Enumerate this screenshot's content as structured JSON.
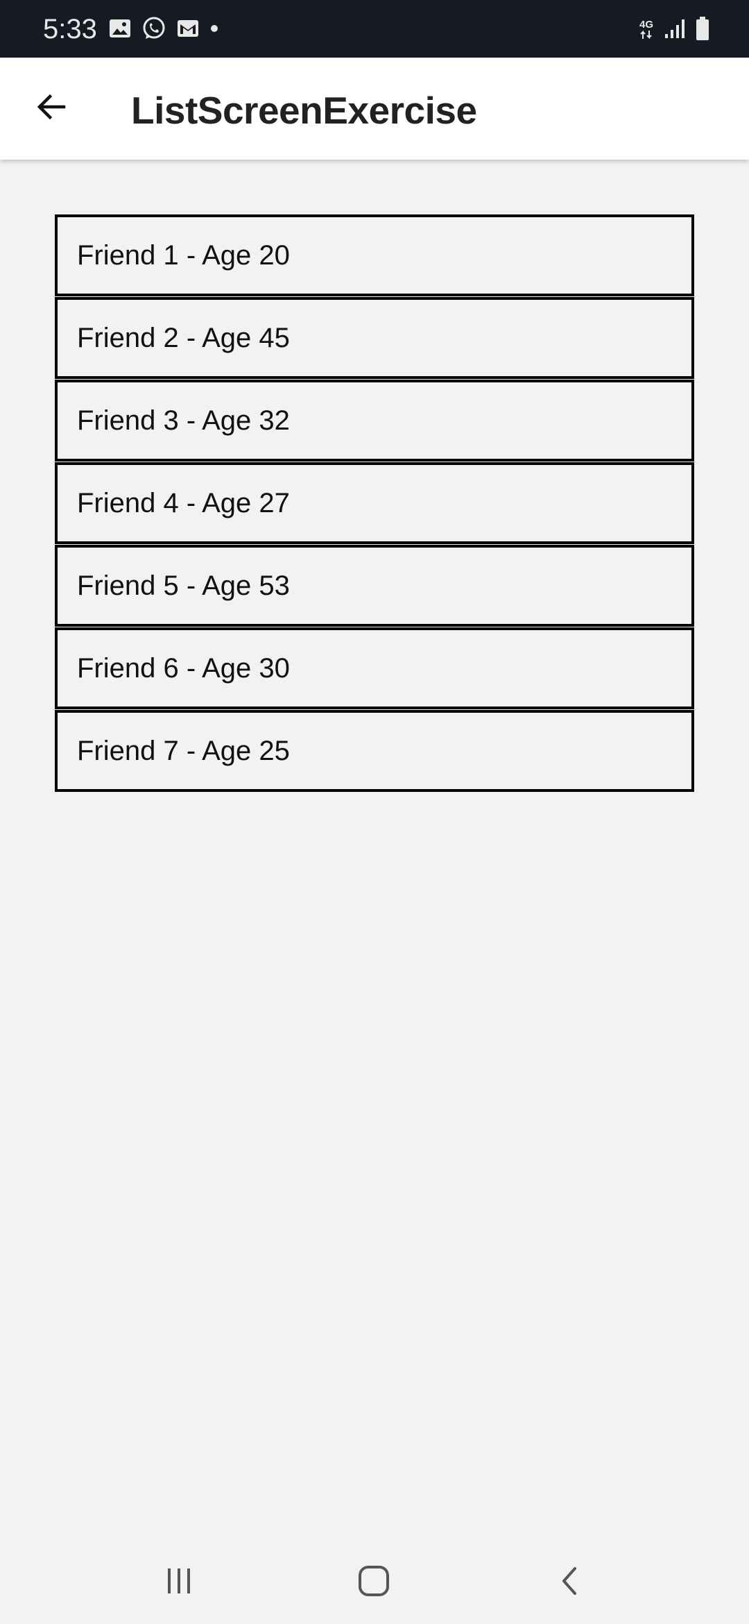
{
  "status_bar": {
    "time": "5:33",
    "left_icons": [
      "image-icon",
      "whatsapp-icon",
      "gmail-icon",
      "notification-dot-icon"
    ],
    "network_type": "4G",
    "right_icons": [
      "network-4g-icon",
      "signal-icon",
      "battery-icon"
    ]
  },
  "app_bar": {
    "back_icon": "arrow-left-icon",
    "title": "ListScreenExercise"
  },
  "friends": [
    {
      "label": "Friend 1 - Age 20"
    },
    {
      "label": "Friend 2 - Age 45"
    },
    {
      "label": "Friend 3 - Age 32"
    },
    {
      "label": "Friend 4 - Age 27"
    },
    {
      "label": "Friend 5 - Age 53"
    },
    {
      "label": "Friend 6 - Age 30"
    },
    {
      "label": "Friend 7 - Age 25"
    }
  ],
  "nav_bar": {
    "icons": [
      "recents-icon",
      "home-icon",
      "back-icon"
    ]
  },
  "colors": {
    "status_bar_bg": "#151a23",
    "app_bar_bg": "#ffffff",
    "background": "#f2f2f2",
    "item_border": "#000000"
  }
}
